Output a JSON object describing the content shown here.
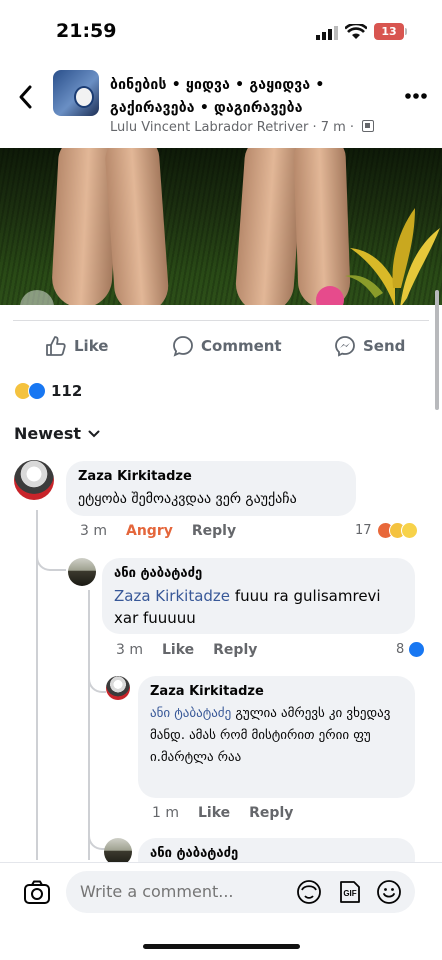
{
  "status_bar": {
    "time": "21:59",
    "battery": "13"
  },
  "header": {
    "group_name": "ბინების • ყიდვა • გაყიდვა • გაქირავება • დაგირავება",
    "author": "Lulu Vincent Labrador Retriver",
    "time_ago": "7 m",
    "icons": {
      "back": "chevron-left-icon",
      "more": "more-horizontal-icon"
    }
  },
  "actions": {
    "like": "Like",
    "comment": "Comment",
    "send": "Send"
  },
  "reactions": {
    "count": "112",
    "types": [
      "sad",
      "like"
    ]
  },
  "sort": {
    "label": "Newest"
  },
  "comments": [
    {
      "author": "Zaza Kirkitadze",
      "text": "ეტყობა შემოაკვდაა ვერ გაუქაჩა",
      "time": "3 m",
      "reaction_label": "Angry",
      "reply": "Reply",
      "reaction_count": "17",
      "reaction_types": [
        "angry",
        "sad",
        "haha"
      ]
    },
    {
      "author": "ანი ტაბატაძე",
      "mention": "Zaza Kirkitadze",
      "text": "fuuu ra gulisamrevi xar fuuuuu",
      "time": "3 m",
      "like": "Like",
      "reply": "Reply",
      "reaction_count": "8",
      "reaction_types": [
        "like"
      ]
    },
    {
      "author": "Zaza Kirkitadze",
      "mention": "ანი ტაბატაძე",
      "text": "გულია ამრევს კი ვხედავ მანდ. ამას რომ მისტირით ერიი ფუ ი.მარტლა რაა",
      "time": "1 m",
      "like": "Like",
      "reply": "Reply"
    },
    {
      "author": "ანი ტაბატაძე"
    }
  ],
  "composer": {
    "placeholder": "Write a comment...",
    "gif": "GIF"
  },
  "colors": {
    "link": "#385898",
    "like_blue": "#1877f2",
    "angry": "#e4663b",
    "bubble": "#f0f2f5"
  }
}
